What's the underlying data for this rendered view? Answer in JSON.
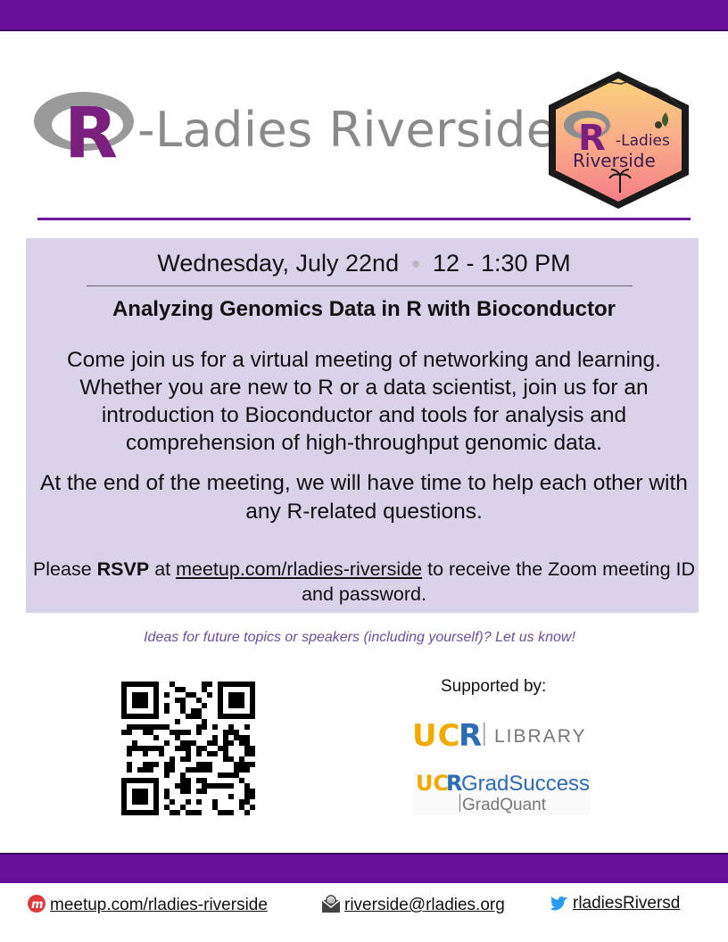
{
  "header": {
    "wordmark_r": "R",
    "wordmark_text": "-Ladies Riverside",
    "hex_line1": "-Ladies",
    "hex_line2": "Riverside"
  },
  "event": {
    "date": "Wednesday, July 22nd",
    "separator": "●",
    "time": "12 - 1:30 PM",
    "title": "Analyzing Genomics Data in R with Bioconductor",
    "description": "Come join us for a virtual meeting of networking and learning. Whether you are new to R or a data scientist, join us for an introduction to Bioconductor and tools for analysis and comprehension of high-throughput genomic data.",
    "closing": "At the end of the meeting, we will have time to help each other with any R-related questions.",
    "rsvp_prefix": "Please ",
    "rsvp_bold": "RSVP",
    "rsvp_at": " at ",
    "rsvp_link": "meetup.com/rladies-riverside",
    "rsvp_suffix": " to receive the Zoom meeting ID and password."
  },
  "ideas_text": "Ideas for future topics or speakers (including yourself)? Let us know!",
  "sponsors": {
    "heading": "Supported by:",
    "library_ucr": "UCR",
    "library_name": "LIBRARY",
    "grad_ucr": "UCR",
    "grad_name": "GradSuccess",
    "grad_sub": "GradQuant"
  },
  "footer": {
    "meetup": "meetup.com/rladies-riverside",
    "email": "riverside@rladies.org",
    "twitter": "rladiesRiversd"
  },
  "colors": {
    "brand_purple": "#650f9c",
    "panel_lavender": "#d9d2e9",
    "ideas_text": "#6b4ea1"
  },
  "icons": {
    "meetup": "meetup-icon",
    "email": "envelope-icon",
    "twitter": "twitter-bird-icon"
  }
}
